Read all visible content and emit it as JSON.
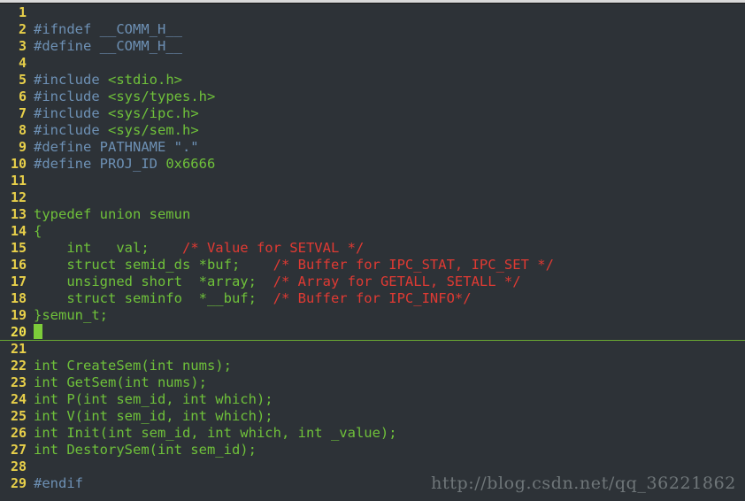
{
  "window": {
    "background_color": "#2d3237",
    "titlebar_color": "#d9d9d9"
  },
  "editor": {
    "gutter": {
      "line_number_color": "#e8d04a",
      "current_line_number_color": "#f3e14e"
    },
    "cursor": {
      "line_number": 20,
      "column": 1,
      "color": "#7dcc3a"
    },
    "syntax_colors": {
      "preprocessor": "#6d90b4",
      "string": "#6fc13a",
      "keyword": "#6fc13a",
      "number": "#6fc13a",
      "identifier": "#6fc13a",
      "comment": "#e03a33"
    },
    "lines": [
      {
        "num": "1",
        "tokens": []
      },
      {
        "num": "2",
        "tokens": [
          {
            "t": "#ifndef __COMM_H__",
            "c": "t-pre"
          }
        ]
      },
      {
        "num": "3",
        "tokens": [
          {
            "t": "#define __COMM_H__",
            "c": "t-pre"
          }
        ]
      },
      {
        "num": "4",
        "tokens": []
      },
      {
        "num": "5",
        "tokens": [
          {
            "t": "#include ",
            "c": "t-pre"
          },
          {
            "t": "<stdio.h>",
            "c": "t-str"
          }
        ]
      },
      {
        "num": "6",
        "tokens": [
          {
            "t": "#include ",
            "c": "t-pre"
          },
          {
            "t": "<sys/types.h>",
            "c": "t-str"
          }
        ]
      },
      {
        "num": "7",
        "tokens": [
          {
            "t": "#include ",
            "c": "t-pre"
          },
          {
            "t": "<sys/ipc.h>",
            "c": "t-str"
          }
        ]
      },
      {
        "num": "8",
        "tokens": [
          {
            "t": "#include ",
            "c": "t-pre"
          },
          {
            "t": "<sys/sem.h>",
            "c": "t-str"
          }
        ]
      },
      {
        "num": "9",
        "tokens": [
          {
            "t": "#define PATHNAME \".\"",
            "c": "t-pre"
          }
        ]
      },
      {
        "num": "10",
        "tokens": [
          {
            "t": "#define PROJ_ID ",
            "c": "t-pre"
          },
          {
            "t": "0x6666",
            "c": "t-num"
          }
        ]
      },
      {
        "num": "11",
        "tokens": []
      },
      {
        "num": "12",
        "tokens": []
      },
      {
        "num": "13",
        "tokens": [
          {
            "t": "typedef union semun",
            "c": "t-kw"
          }
        ]
      },
      {
        "num": "14",
        "tokens": [
          {
            "t": "{",
            "c": "t-plain"
          }
        ]
      },
      {
        "num": "15",
        "tokens": [
          {
            "t": "    int   val;    ",
            "c": "t-kw"
          },
          {
            "t": "/* Value for SETVAL */",
            "c": "t-cmt"
          }
        ]
      },
      {
        "num": "16",
        "tokens": [
          {
            "t": "    struct semid_ds *buf;    ",
            "c": "t-kw"
          },
          {
            "t": "/* Buffer for IPC_STAT, IPC_SET */",
            "c": "t-cmt"
          }
        ]
      },
      {
        "num": "17",
        "tokens": [
          {
            "t": "    unsigned short  *array;  ",
            "c": "t-kw"
          },
          {
            "t": "/* Array for GETALL, SETALL */",
            "c": "t-cmt"
          }
        ]
      },
      {
        "num": "18",
        "tokens": [
          {
            "t": "    struct seminfo  *__buf;  ",
            "c": "t-kw"
          },
          {
            "t": "/* Buffer for IPC_INFO*/",
            "c": "t-cmt"
          }
        ]
      },
      {
        "num": "19",
        "tokens": [
          {
            "t": "}semun_t;",
            "c": "t-plain"
          }
        ]
      },
      {
        "num": "20",
        "tokens": [],
        "cursor": true,
        "cursorline": true
      },
      {
        "num": "21",
        "tokens": []
      },
      {
        "num": "22",
        "tokens": [
          {
            "t": "int CreateSem(int nums);",
            "c": "t-kw"
          }
        ]
      },
      {
        "num": "23",
        "tokens": [
          {
            "t": "int GetSem(int nums);",
            "c": "t-kw"
          }
        ]
      },
      {
        "num": "24",
        "tokens": [
          {
            "t": "int P(int sem_id, int which);",
            "c": "t-kw"
          }
        ]
      },
      {
        "num": "25",
        "tokens": [
          {
            "t": "int V(int sem_id, int which);",
            "c": "t-kw"
          }
        ]
      },
      {
        "num": "26",
        "tokens": [
          {
            "t": "int Init(int sem_id, int which, int _value);",
            "c": "t-kw"
          }
        ]
      },
      {
        "num": "27",
        "tokens": [
          {
            "t": "int DestorySem(int sem_id);",
            "c": "t-kw"
          }
        ]
      },
      {
        "num": "28",
        "tokens": []
      },
      {
        "num": "29",
        "tokens": [
          {
            "t": "#endif",
            "c": "t-pre"
          }
        ]
      }
    ]
  },
  "watermark": {
    "text": "http://blog.csdn.net/qq_36221862",
    "color": "#6f7679"
  }
}
